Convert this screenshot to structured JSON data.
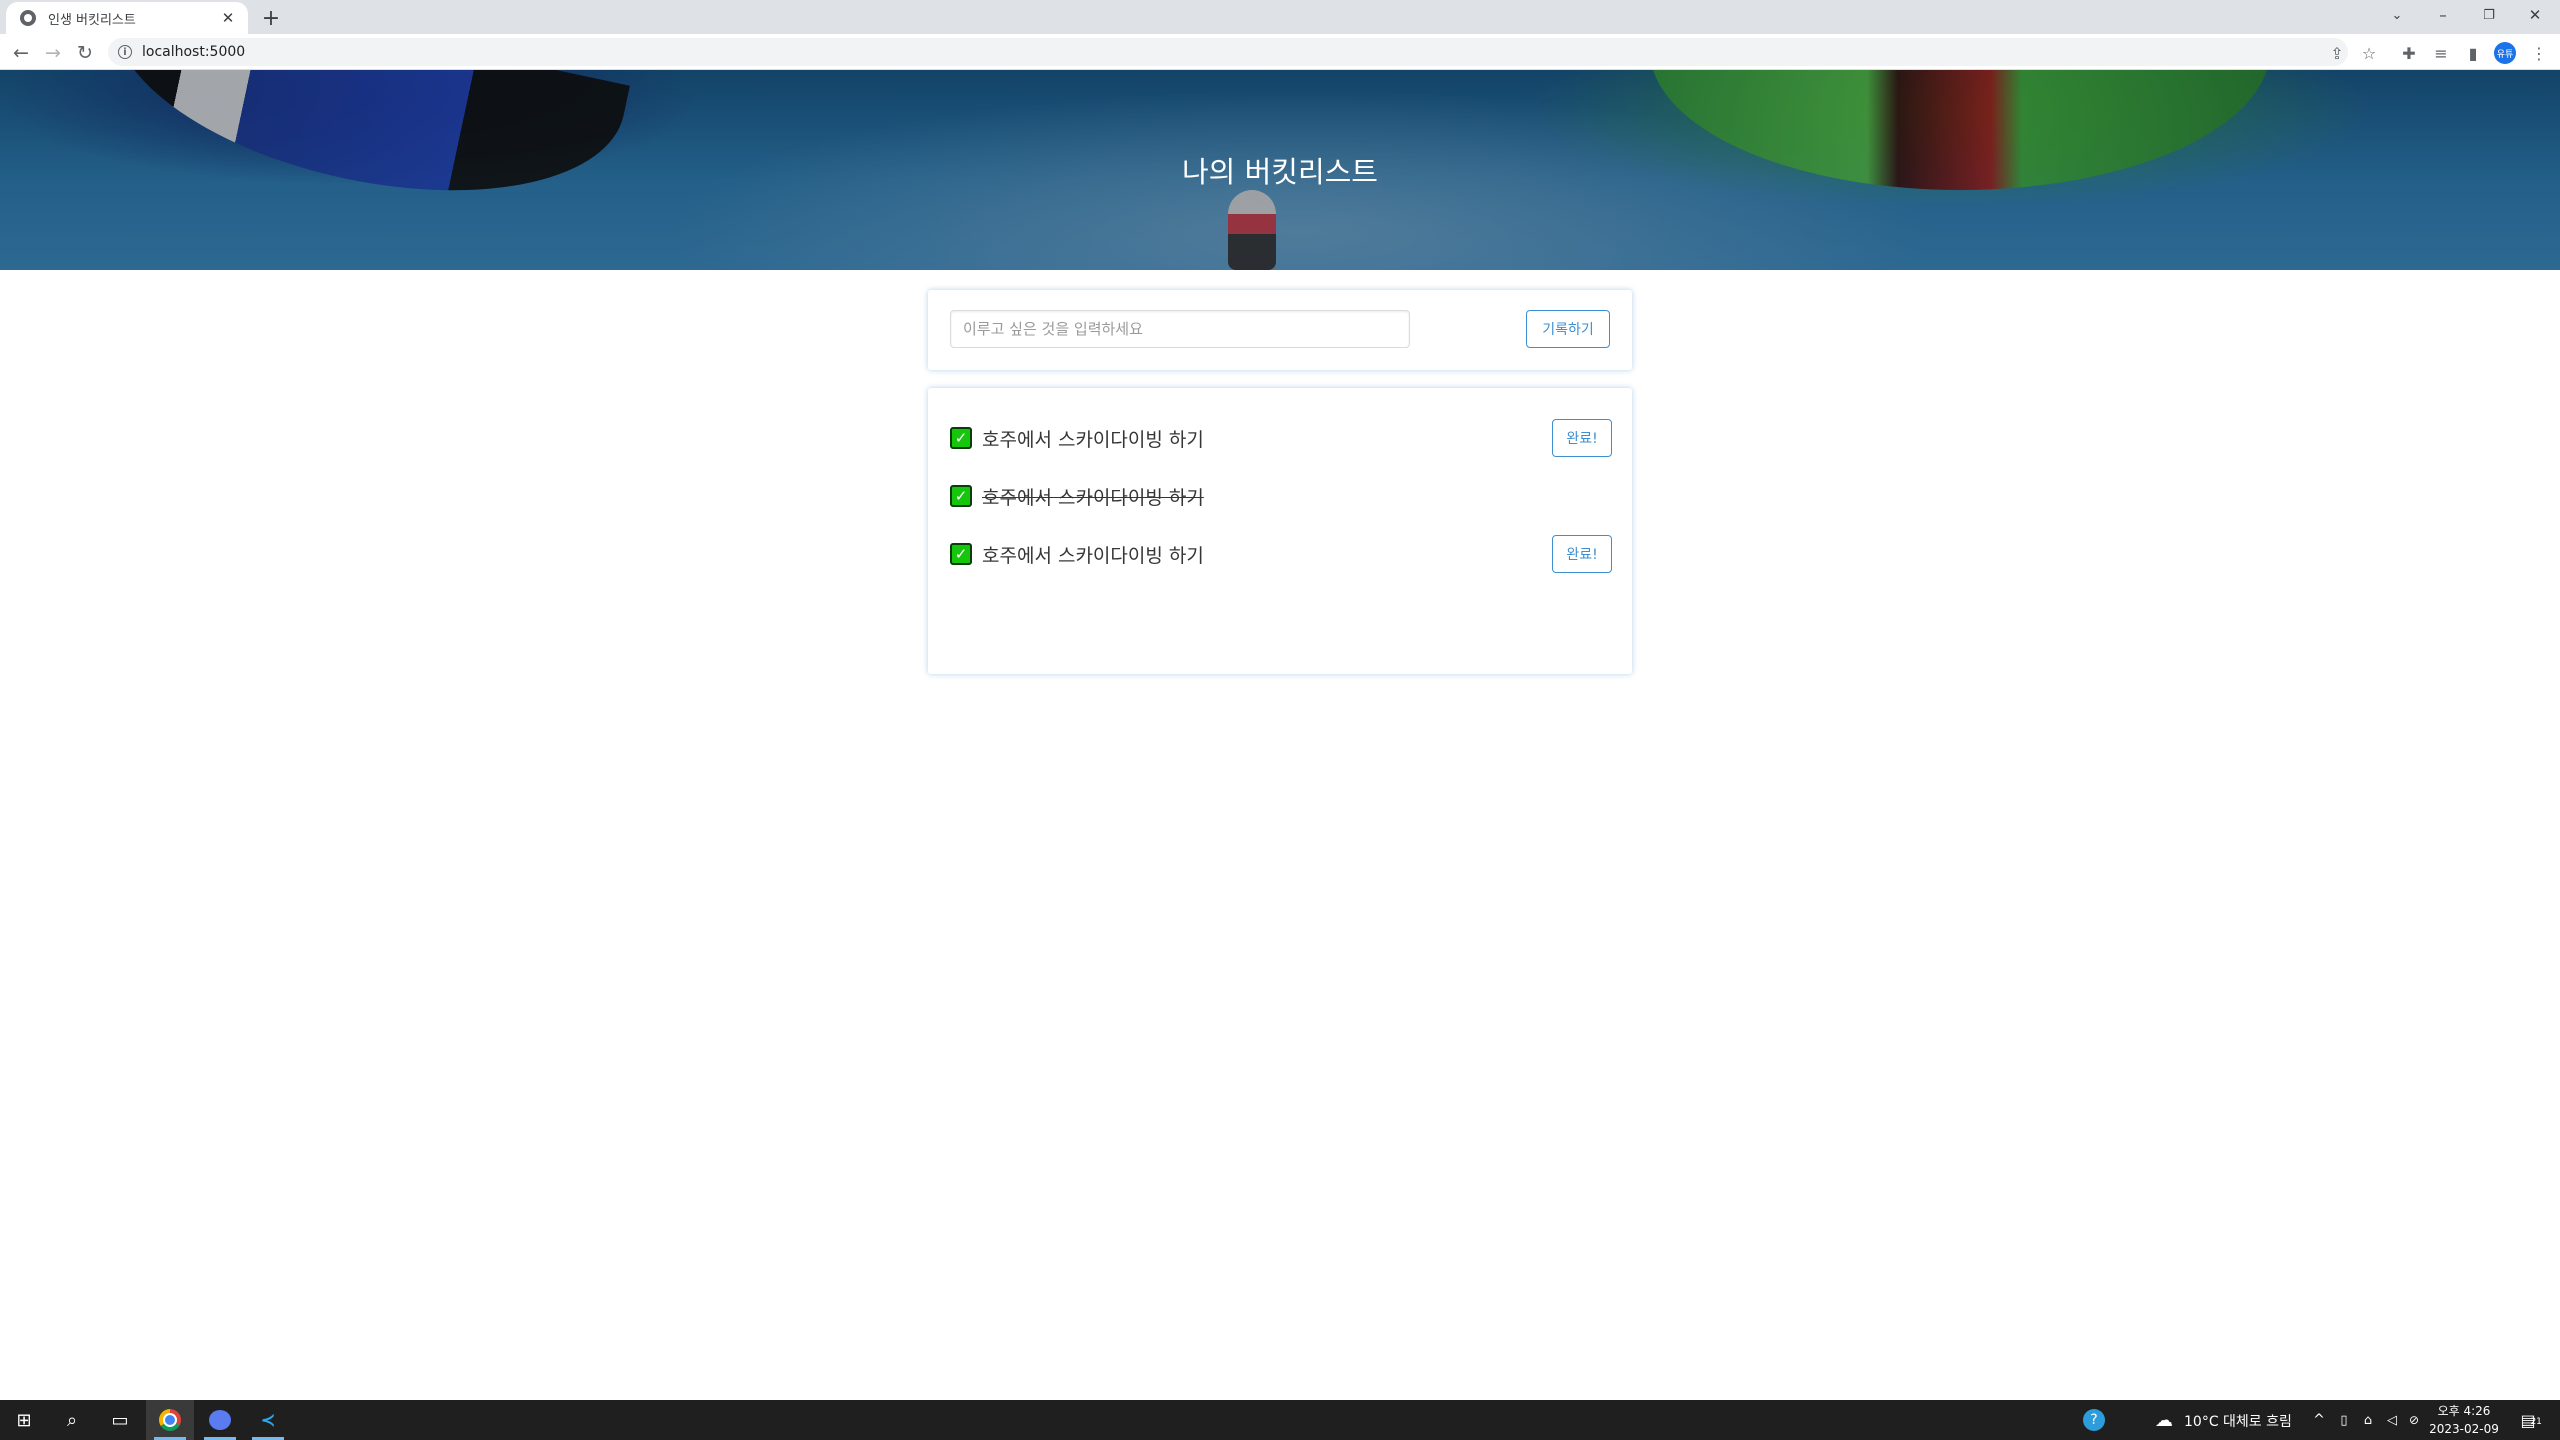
{
  "browser": {
    "tab_title": "인생 버킷리스트",
    "tab_close": "✕",
    "new_tab": "+",
    "url": "localhost:5000",
    "profile_initials": "유튜"
  },
  "hero": {
    "title": "나의 버킷리스트"
  },
  "form": {
    "placeholder": "이루고 싶은 것을 입력하세요",
    "value": "",
    "submit_label": "기록하기"
  },
  "bucket_list": {
    "items": [
      {
        "text": "호주에서 스카이다이빙 하기",
        "done": false,
        "button_label": "완료!"
      },
      {
        "text": "호주에서 스카이다이빙 하기",
        "done": true
      },
      {
        "text": "호주에서 스카이다이빙 하기",
        "done": false,
        "button_label": "완료!"
      }
    ]
  },
  "taskbar": {
    "weather": "10°C  대체로 흐림",
    "clock_time": "오후 4:26",
    "clock_date": "2023-02-09",
    "notification_count": "21"
  },
  "colors": {
    "accent": "#3e8ed0",
    "check_green": "#16c60c",
    "taskbar": "#1f1f1f"
  }
}
